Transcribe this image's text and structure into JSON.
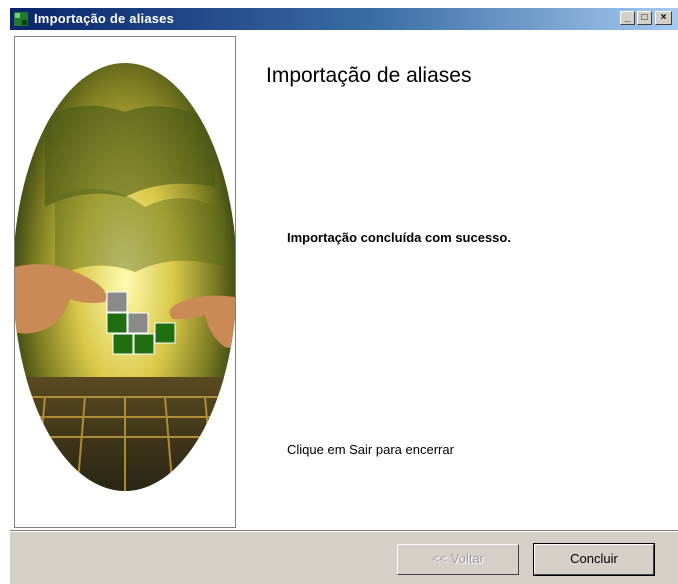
{
  "window": {
    "title": "Importação de aliases",
    "controls": {
      "minimize": "_",
      "maximize": "□",
      "close": "×"
    }
  },
  "content": {
    "heading": "Importação de aliases",
    "message": "Importação concluída com sucesso.",
    "hint": "Clique em Sair para encerrar"
  },
  "buttons": {
    "back": {
      "label": "<< Voltar",
      "enabled": false
    },
    "finish": {
      "label": "Concluir",
      "enabled": true
    }
  },
  "icons": {
    "app": "app-icon",
    "banner": "wizard-banner-image"
  },
  "colors": {
    "titlebar_start": "#0a246a",
    "titlebar_end": "#a6caf0",
    "dialog_face": "#d4d0c8",
    "logo_green": "#1f6e10",
    "logo_gray": "#8a8a8a"
  }
}
